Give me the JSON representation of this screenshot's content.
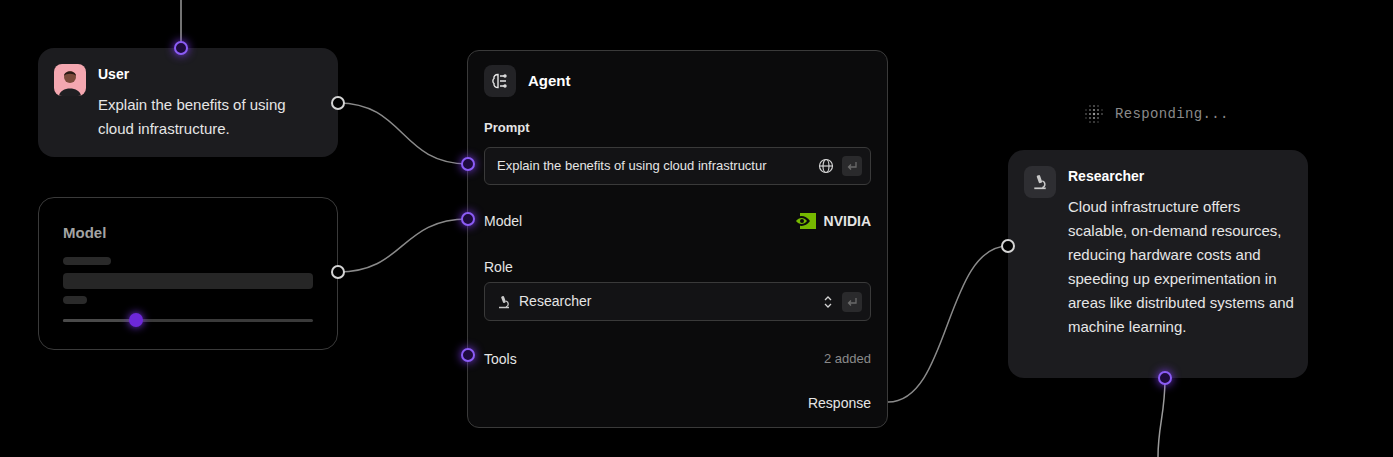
{
  "user": {
    "title": "User",
    "message": "Explain the benefits of using cloud infrastructure."
  },
  "model_node": {
    "title": "Model",
    "slider": {
      "level": 0.29
    }
  },
  "agent": {
    "title": "Agent",
    "prompt_label": "Prompt",
    "prompt_value": "Explain the benefits of using cloud infrastructur",
    "model_label": "Model",
    "model_provider": "NVIDIA",
    "role_label": "Role",
    "role_value": "Researcher",
    "tools_label": "Tools",
    "tools_count": "2 added",
    "response_label": "Response"
  },
  "status": "Responding...",
  "researcher": {
    "title": "Researcher",
    "message": "Cloud infrastructure offers scalable, on-demand resources, reducing hardware costs and speeding up experimentation in areas like distributed systems and machine learning."
  }
}
